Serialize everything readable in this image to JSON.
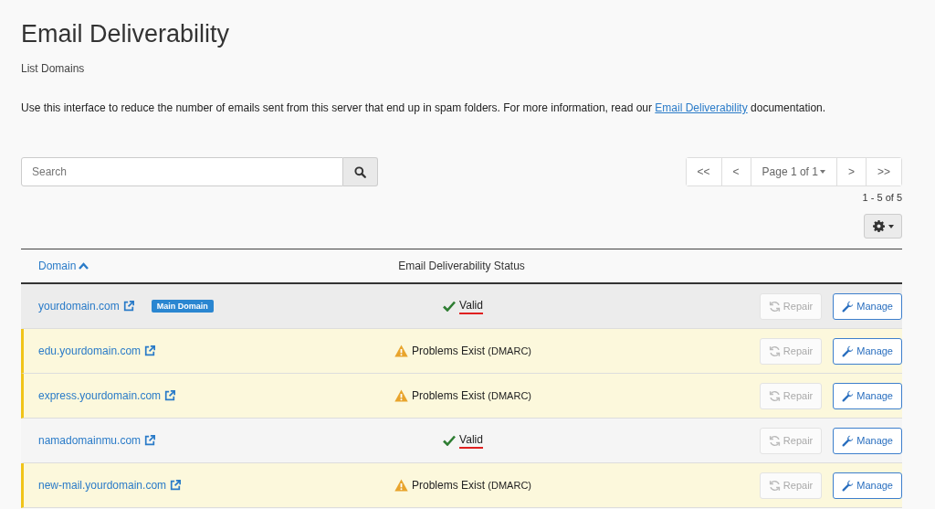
{
  "page": {
    "title": "Email Deliverability",
    "subtitle": "List Domains",
    "description": {
      "before": "Use this interface to reduce the number of emails sent from this server that end up in spam folders. For more information, read our ",
      "link": "Email Deliverability",
      "after": " documentation."
    }
  },
  "search": {
    "placeholder": "Search"
  },
  "pagination": {
    "buttons": [
      "<<",
      "<",
      "Page 1 of 1",
      ">",
      ">>"
    ],
    "summary": "1 - 5 of 5"
  },
  "table": {
    "columns": [
      {
        "label": "Domain",
        "sorted": true
      },
      {
        "label": "Email Deliverability Status",
        "sorted": false
      }
    ],
    "rows": [
      {
        "domain": "yourdomain.com",
        "badge": "Main Domain",
        "kind": "main",
        "status": {
          "kind": "valid",
          "text": "Valid",
          "underlined": true
        },
        "repair": {
          "label": "Repair",
          "disabled": true
        },
        "manage": "Manage"
      },
      {
        "domain": "edu.yourdomain.com",
        "kind": "warning",
        "status": {
          "kind": "problems",
          "text": "Problems Exist",
          "detail": "(DMARC)",
          "underlined": false
        },
        "repair": {
          "label": "Repair",
          "disabled": true
        },
        "manage": "Manage"
      },
      {
        "domain": "express.yourdomain.com",
        "kind": "warning",
        "status": {
          "kind": "problems",
          "text": "Problems Exist",
          "detail": "(DMARC)",
          "underlined": false
        },
        "repair": {
          "label": "Repair",
          "disabled": true
        },
        "manage": "Manage"
      },
      {
        "domain": "namadomainmu.com",
        "kind": "normal",
        "status": {
          "kind": "valid",
          "text": "Valid",
          "underlined": true
        },
        "repair": {
          "label": "Repair",
          "disabled": true
        },
        "manage": "Manage"
      },
      {
        "domain": "new-mail.yourdomain.com",
        "kind": "warning",
        "status": {
          "kind": "problems",
          "text": "Problems Exist",
          "detail": "(DMARC)",
          "underlined": false
        },
        "repair": {
          "label": "Repair",
          "disabled": true
        },
        "manage": "Manage"
      }
    ]
  }
}
